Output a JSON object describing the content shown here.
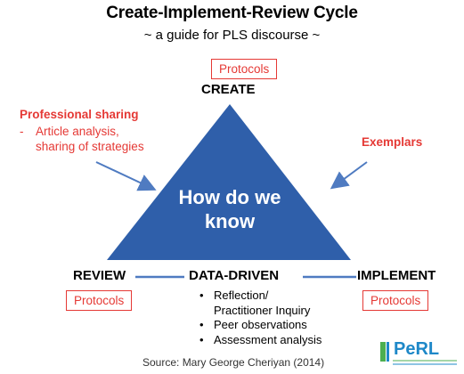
{
  "title": "Create-Implement-Review Cycle",
  "subtitle": "~ a guide for PLS discourse ~",
  "create": {
    "protocols_label": "Protocols",
    "label": "CREATE"
  },
  "review": {
    "label": "REVIEW",
    "protocols_label": "Protocols"
  },
  "implement": {
    "label": "IMPLEMENT",
    "protocols_label": "Protocols"
  },
  "data_driven": {
    "label": "DATA-DRIVEN",
    "items": [
      "Reflection/ Practitioner Inquiry",
      "Peer observations",
      "Assessment analysis"
    ]
  },
  "professional_sharing": {
    "heading": "Professional sharing",
    "detail": "Article analysis, sharing of strategies"
  },
  "exemplars": "Exemplars",
  "center_text": "How do we know",
  "source": "Source: Mary George Cheriyan (2014)",
  "logo": {
    "text": "PeRL",
    "colors": {
      "brand_blue": "#1e88c8",
      "brand_green": "#4caf50"
    }
  },
  "colors": {
    "accent_red": "#e53935",
    "triangle_blue": "#2f5faa",
    "arrow_blue": "#4f7bc1"
  }
}
